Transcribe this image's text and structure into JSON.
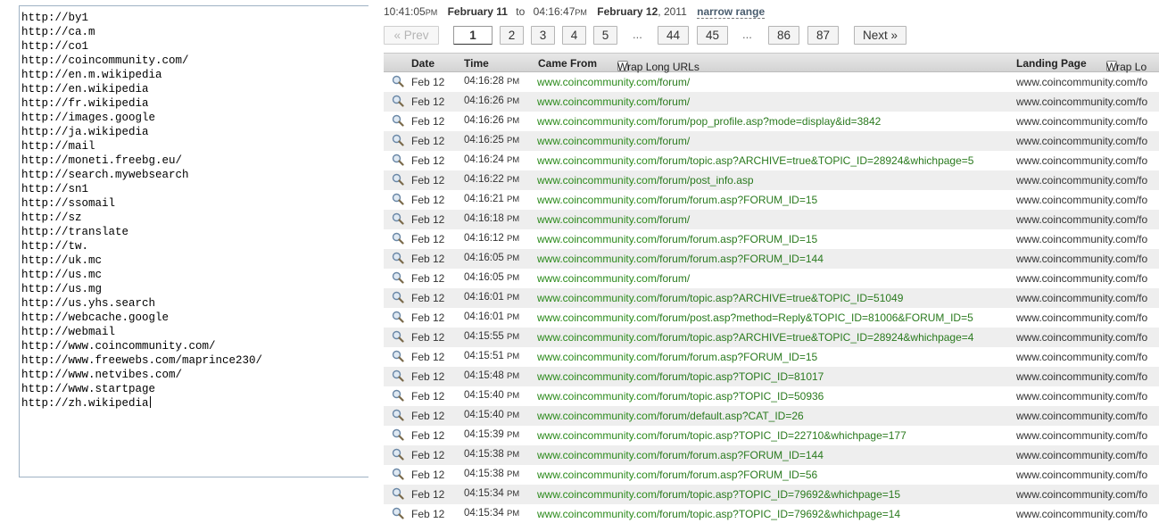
{
  "url_list": [
    "http://by1",
    "http://ca.m",
    "http://co1",
    "http://coincommunity.com/",
    "http://en.m.wikipedia",
    "http://en.wikipedia",
    "http://fr.wikipedia",
    "http://images.google",
    "http://ja.wikipedia",
    "http://mail",
    "http://moneti.freebg.eu/",
    "http://search.mywebsearch",
    "http://sn1",
    "http://ssomail",
    "http://sz",
    "http://translate",
    "http://tw.",
    "http://uk.mc",
    "http://us.mc",
    "http://us.mg",
    "http://us.yhs.search",
    "http://webcache.google",
    "http://webmail",
    "http://www.coincommunity.com/",
    "http://www.freewebs.com/maprince230/",
    "http://www.netvibes.com/",
    "http://www.startpage",
    "http://zh.wikipedia"
  ],
  "range": {
    "start_time": "10:41:",
    "start_sec": "05",
    "start_ampm": "PM",
    "start_date": "February 11",
    "to": "to",
    "end_time": "04:16:",
    "end_sec": "47",
    "end_ampm": "PM",
    "end_date": "February 12",
    "end_year": ", 2011",
    "narrow_label": "narrow range"
  },
  "pager": {
    "prev": "« Prev",
    "next": "Next »",
    "dots": "...",
    "pages": [
      "1",
      "2",
      "3",
      "4",
      "5",
      "44",
      "45",
      "86",
      "87"
    ],
    "current": "1"
  },
  "table": {
    "headers": {
      "date": "Date",
      "time": "Time",
      "came_from": "Came From",
      "wrap1": "Wrap Long URLs",
      "landing": "Landing Page",
      "wrap2": "Wrap Lo"
    },
    "host": "www.coincommunity.com",
    "rows": [
      {
        "date": "Feb 12",
        "time": "04:16:28",
        "ampm": "PM",
        "path": "/forum/",
        "landing": "www.coincommunity.com/fo"
      },
      {
        "date": "Feb 12",
        "time": "04:16:26",
        "ampm": "PM",
        "path": "/forum/",
        "landing": "www.coincommunity.com/fo"
      },
      {
        "date": "Feb 12",
        "time": "04:16:26",
        "ampm": "PM",
        "path": "/forum/pop_profile.asp?mode=display&id=3842",
        "landing": "www.coincommunity.com/fo"
      },
      {
        "date": "Feb 12",
        "time": "04:16:25",
        "ampm": "PM",
        "path": "/forum/",
        "landing": "www.coincommunity.com/fo"
      },
      {
        "date": "Feb 12",
        "time": "04:16:24",
        "ampm": "PM",
        "path": "/forum/topic.asp?ARCHIVE=true&TOPIC_ID=28924&whichpage=5",
        "landing": "www.coincommunity.com/fo"
      },
      {
        "date": "Feb 12",
        "time": "04:16:22",
        "ampm": "PM",
        "path": "/forum/post_info.asp",
        "landing": "www.coincommunity.com/fo"
      },
      {
        "date": "Feb 12",
        "time": "04:16:21",
        "ampm": "PM",
        "path": "/forum/forum.asp?FORUM_ID=15",
        "landing": "www.coincommunity.com/fo"
      },
      {
        "date": "Feb 12",
        "time": "04:16:18",
        "ampm": "PM",
        "path": "/forum/",
        "landing": "www.coincommunity.com/fo"
      },
      {
        "date": "Feb 12",
        "time": "04:16:12",
        "ampm": "PM",
        "path": "/forum/forum.asp?FORUM_ID=15",
        "landing": "www.coincommunity.com/fo"
      },
      {
        "date": "Feb 12",
        "time": "04:16:05",
        "ampm": "PM",
        "path": "/forum/forum.asp?FORUM_ID=144",
        "landing": "www.coincommunity.com/fo"
      },
      {
        "date": "Feb 12",
        "time": "04:16:05",
        "ampm": "PM",
        "path": "/forum/",
        "landing": "www.coincommunity.com/fo"
      },
      {
        "date": "Feb 12",
        "time": "04:16:01",
        "ampm": "PM",
        "path": "/forum/topic.asp?ARCHIVE=true&TOPIC_ID=51049",
        "landing": "www.coincommunity.com/fo"
      },
      {
        "date": "Feb 12",
        "time": "04:16:01",
        "ampm": "PM",
        "path": "/forum/post.asp?method=Reply&TOPIC_ID=81006&FORUM_ID=5",
        "landing": "www.coincommunity.com/fo"
      },
      {
        "date": "Feb 12",
        "time": "04:15:55",
        "ampm": "PM",
        "path": "/forum/topic.asp?ARCHIVE=true&TOPIC_ID=28924&whichpage=4",
        "landing": "www.coincommunity.com/fo"
      },
      {
        "date": "Feb 12",
        "time": "04:15:51",
        "ampm": "PM",
        "path": "/forum/forum.asp?FORUM_ID=15",
        "landing": "www.coincommunity.com/fo"
      },
      {
        "date": "Feb 12",
        "time": "04:15:48",
        "ampm": "PM",
        "path": "/forum/topic.asp?TOPIC_ID=81017",
        "landing": "www.coincommunity.com/fo"
      },
      {
        "date": "Feb 12",
        "time": "04:15:40",
        "ampm": "PM",
        "path": "/forum/topic.asp?TOPIC_ID=50936",
        "landing": "www.coincommunity.com/fo"
      },
      {
        "date": "Feb 12",
        "time": "04:15:40",
        "ampm": "PM",
        "path": "/forum/default.asp?CAT_ID=26",
        "landing": "www.coincommunity.com/fo"
      },
      {
        "date": "Feb 12",
        "time": "04:15:39",
        "ampm": "PM",
        "path": "/forum/topic.asp?TOPIC_ID=22710&whichpage=177",
        "landing": "www.coincommunity.com/fo"
      },
      {
        "date": "Feb 12",
        "time": "04:15:38",
        "ampm": "PM",
        "path": "/forum/forum.asp?FORUM_ID=144",
        "landing": "www.coincommunity.com/fo"
      },
      {
        "date": "Feb 12",
        "time": "04:15:38",
        "ampm": "PM",
        "path": "/forum/forum.asp?FORUM_ID=56",
        "landing": "www.coincommunity.com/fo"
      },
      {
        "date": "Feb 12",
        "time": "04:15:34",
        "ampm": "PM",
        "path": "/forum/topic.asp?TOPIC_ID=79692&whichpage=15",
        "landing": "www.coincommunity.com/fo"
      },
      {
        "date": "Feb 12",
        "time": "04:15:34",
        "ampm": "PM",
        "path": "/forum/topic.asp?TOPIC_ID=79692&whichpage=14",
        "landing": "www.coincommunity.com/fo"
      }
    ]
  },
  "icons": {
    "row_detail": "magnifier-icon",
    "wrap_checkbox": "checkbox-icon"
  },
  "colors": {
    "link_green": "#2b8a1b",
    "header_bg": "#d9d9d9",
    "alt_row": "#eeeeee"
  }
}
